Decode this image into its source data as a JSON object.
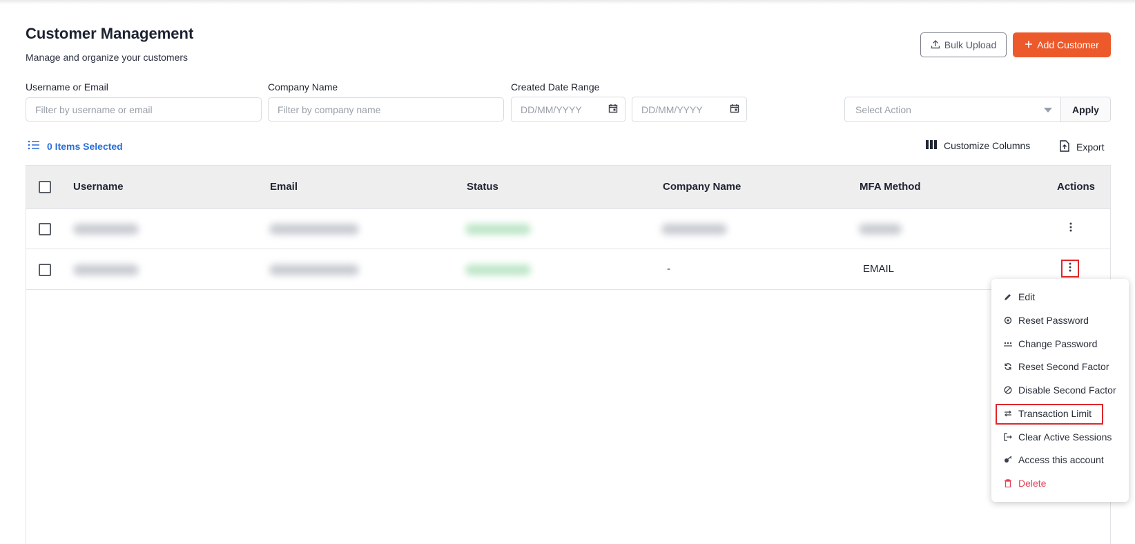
{
  "header": {
    "title": "Customer Management",
    "subtitle": "Manage and organize your customers",
    "bulk_upload_label": "Bulk Upload",
    "add_customer_label": "Add Customer"
  },
  "filters": {
    "username_label": "Username or Email",
    "username_placeholder": "Filter by username or email",
    "company_label": "Company Name",
    "company_placeholder": "Filter by company name",
    "date_label": "Created Date Range",
    "date_from_placeholder": "DD/MM/YYYY",
    "date_to_placeholder": "DD/MM/YYYY",
    "action_placeholder": "Select Action",
    "apply_label": "Apply"
  },
  "toolbar": {
    "selected_count": "0 Items Selected",
    "customize_columns": "Customize Columns",
    "export": "Export"
  },
  "table": {
    "columns": [
      "Username",
      "Email",
      "Status",
      "Company Name",
      "MFA Method",
      "Actions"
    ],
    "rows": [
      {
        "company": "",
        "mfa": ""
      },
      {
        "company": "-",
        "mfa": "EMAIL"
      }
    ]
  },
  "menu": {
    "items": [
      {
        "label": "Edit",
        "icon": "pencil-icon"
      },
      {
        "label": "Reset Password",
        "icon": "reset-password-icon"
      },
      {
        "label": "Change Password",
        "icon": "password-dots-icon"
      },
      {
        "label": "Reset Second Factor",
        "icon": "refresh-icon"
      },
      {
        "label": "Disable Second Factor",
        "icon": "disable-icon"
      },
      {
        "label": "Transaction Limit",
        "icon": "transfer-arrows-icon"
      },
      {
        "label": "Clear Active Sessions",
        "icon": "logout-icon"
      },
      {
        "label": "Access this account",
        "icon": "access-key-icon"
      },
      {
        "label": "Delete",
        "icon": "trash-icon"
      }
    ]
  },
  "colors": {
    "primary": "#ec5a2c",
    "link": "#2a6fd6",
    "danger": "#e0445a",
    "highlight": "#e0262b"
  }
}
